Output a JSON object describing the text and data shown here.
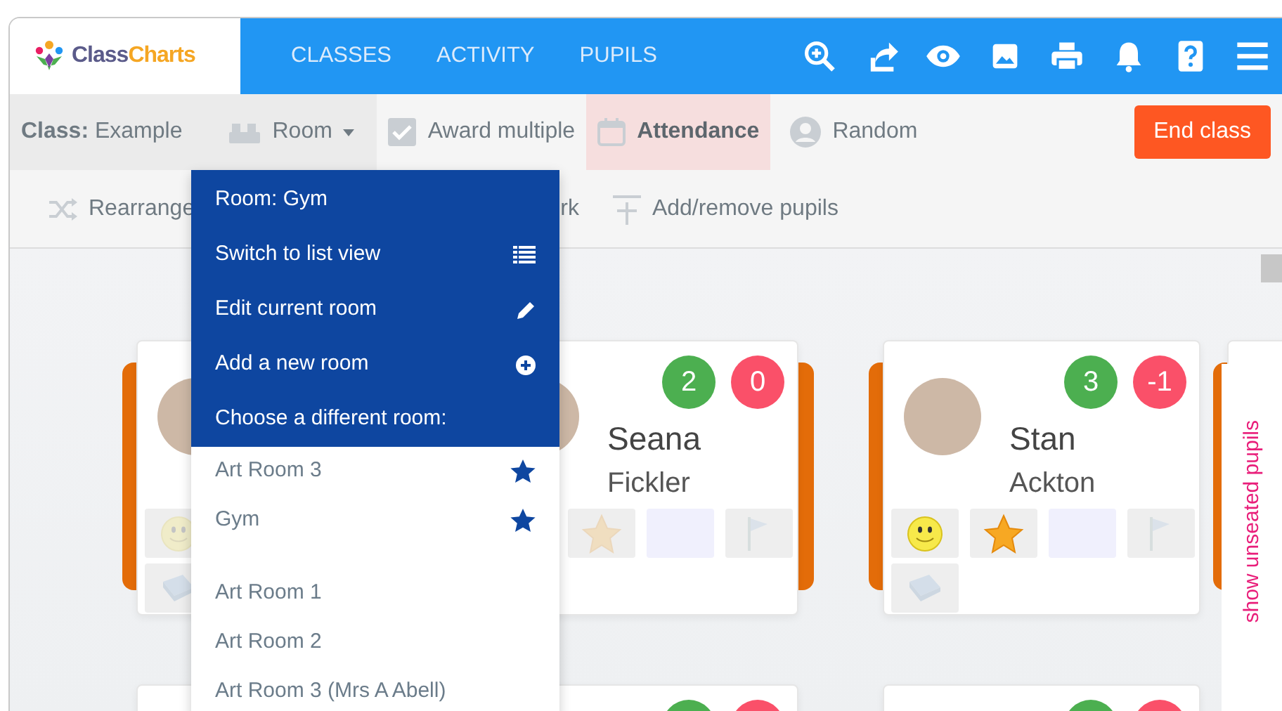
{
  "logo": {
    "part1": "Class",
    "part2": "Charts"
  },
  "nav": [
    {
      "label": "CLASSES"
    },
    {
      "label": "ACTIVITY"
    },
    {
      "label": "PUPILS"
    }
  ],
  "toolbar": {
    "class_label": "Class:",
    "class_name": "Example",
    "items": [
      {
        "kind": "room",
        "label": "Room",
        "expanded": true
      },
      {
        "kind": "checkbox",
        "label": "Award multiple",
        "checked": true
      },
      {
        "kind": "attendance",
        "label": "Attendance",
        "on": true
      },
      {
        "kind": "random",
        "label": "Random"
      }
    ],
    "end_button": "End class"
  },
  "toolbar2": [
    {
      "kind": "rearrange",
      "label": "Rearrange"
    },
    {
      "kind": "covered",
      "label": "rk"
    },
    {
      "kind": "add_remove",
      "label": "Add/remove pupils"
    }
  ],
  "room_menu": {
    "title": "Room: Gym",
    "actions": [
      {
        "kind": "list",
        "label": "Switch to list view"
      },
      {
        "kind": "edit",
        "label": "Edit current room"
      },
      {
        "kind": "add",
        "label": "Add a new room"
      }
    ],
    "section": "Choose a different room:",
    "favourite_rooms": [
      {
        "name": "Art Room 3",
        "starred": true
      },
      {
        "name": "Gym",
        "starred": true
      }
    ],
    "other_rooms": [
      {
        "name": "Art Room 1",
        "starred": false
      },
      {
        "name": "Art Room 2",
        "starred": false
      },
      {
        "name": "Art Room 3 (Mrs A Abell)",
        "starred": false
      }
    ]
  },
  "seat_rows": [
    [
      {
        "kind": "full",
        "photo": true,
        "desk_left": true,
        "tiles": [
          {
            "kind": "smiley",
            "active": false
          },
          {
            "kind": "covered"
          },
          {
            "kind": "covered"
          },
          {
            "kind": "covered"
          },
          {
            "kind": "book",
            "active": false
          }
        ]
      },
      {
        "kind": "full",
        "photo": true,
        "desk_right": true,
        "first_name": "Seana",
        "last_name": "Fickler",
        "positive": "2",
        "negative": "0",
        "tiles": [
          {
            "kind": "covered"
          },
          {
            "kind": "star",
            "active": false
          },
          {
            "kind": "blank"
          },
          {
            "kind": "flag",
            "active": false
          }
        ]
      },
      {
        "kind": "full",
        "photo": true,
        "desk_left": true,
        "first_name": "Stan",
        "last_name": "Ackton",
        "positive": "3",
        "negative": "-1",
        "tiles": [
          {
            "kind": "smiley",
            "active": true
          },
          {
            "kind": "star",
            "active": true
          },
          {
            "kind": "blank"
          },
          {
            "kind": "flag",
            "active": false
          },
          {
            "kind": "book",
            "active": false
          }
        ]
      },
      {
        "kind": "full",
        "desk_left": true
      }
    ],
    [
      {
        "kind": "cut_off"
      },
      {
        "kind": "cut_off"
      },
      {
        "kind": "cut_off"
      }
    ]
  ],
  "unseated_tab": "show unseated pupils"
}
